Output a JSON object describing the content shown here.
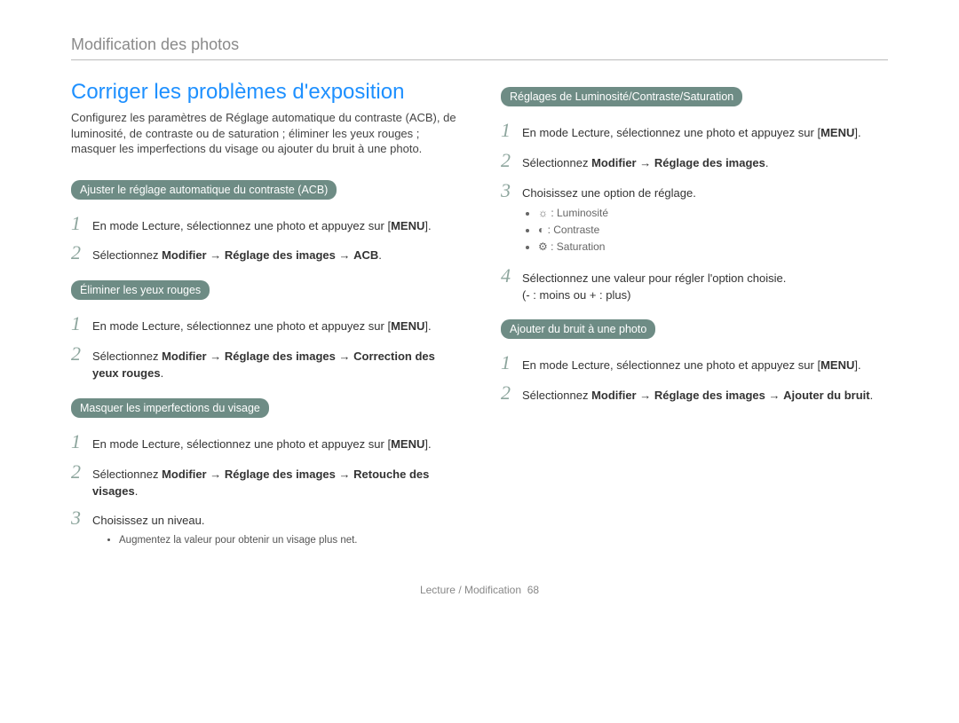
{
  "breadcrumb": "Modification des photos",
  "title": "Corriger les problèmes d'exposition",
  "intro": "Configurez les paramètres de Réglage automatique du contraste (ACB), de luminosité, de contraste ou de saturation ; éliminer les yeux rouges ; masquer les imperfections du visage ou ajouter du bruit à une photo.",
  "menu_label": "MENU",
  "arrow": "→",
  "acb": {
    "heading": "Ajuster le réglage automatique du contraste (ACB)",
    "step1_pre": "En mode Lecture, sélectionnez une photo et appuyez sur ",
    "step2_pre": "Sélectionnez ",
    "step2_b1": "Modifier",
    "step2_b2": "Réglage des images",
    "step2_b3": "ACB"
  },
  "redeye": {
    "heading": "Éliminer les yeux rouges",
    "step1_pre": "En mode Lecture, sélectionnez une photo et appuyez sur ",
    "step2_pre": "Sélectionnez ",
    "step2_b1": "Modifier",
    "step2_b2": "Réglage des images",
    "step2_b3": "Correction des yeux rouges"
  },
  "face": {
    "heading": "Masquer les imperfections du visage",
    "step1_pre": "En mode Lecture, sélectionnez une photo et appuyez sur ",
    "step2_pre": "Sélectionnez ",
    "step2_b1": "Modifier",
    "step2_b2": "Réglage des images",
    "step2_b3": "Retouche des visages",
    "step3": "Choisissez un niveau.",
    "note": "Augmentez la valeur pour obtenir un visage plus net."
  },
  "bcs": {
    "heading": "Réglages de Luminosité/Contraste/Saturation",
    "step1_pre": "En mode Lecture, sélectionnez une photo et appuyez sur ",
    "step2_pre": "Sélectionnez ",
    "step2_b1": "Modifier",
    "step2_b2": "Réglage des images",
    "step3": "Choisissez une option de réglage.",
    "opt1_icon": "☼",
    "opt1_label": " : Luminosité",
    "opt2_icon": "◐",
    "opt2_label": " : Contraste",
    "opt3_icon": "⚙",
    "opt3_label": " : Saturation",
    "step4_line1": "Sélectionnez une valeur pour régler l'option choisie.",
    "step4_line2": "(- : moins ou + : plus)"
  },
  "noise": {
    "heading": "Ajouter du bruit à une photo",
    "step1_pre": "En mode Lecture, sélectionnez une photo et appuyez sur ",
    "step2_pre": "Sélectionnez ",
    "step2_b1": "Modifier",
    "step2_b2": "Réglage des images",
    "step2_b3": "Ajouter du bruit"
  },
  "footer_section": "Lecture / Modification",
  "footer_page": "68"
}
